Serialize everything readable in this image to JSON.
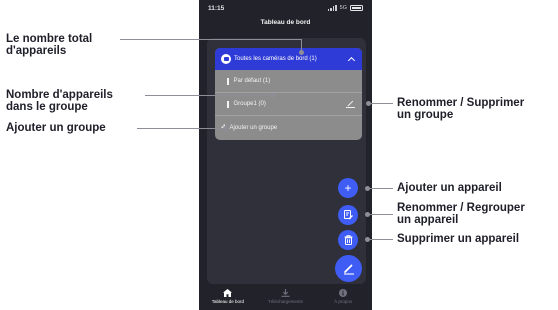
{
  "status_bar": {
    "time": "11:15",
    "network": "5G"
  },
  "header": {
    "title": "Tableau de bord"
  },
  "group_panel": {
    "header_label": "Toutes les caméras de bord (1)",
    "groups": [
      {
        "label": "Par défaut (1)"
      },
      {
        "label": "Groupe1 (0)"
      }
    ],
    "add_group_label": "Ajouter un groupe"
  },
  "bottom_nav": {
    "items": [
      {
        "label": "Tableau de bord",
        "icon": "home-icon",
        "active": true
      },
      {
        "label": "Téléchargements",
        "icon": "download-icon",
        "active": false
      },
      {
        "label": "À propos",
        "icon": "info-icon",
        "active": false
      }
    ]
  },
  "annotations": {
    "total_devices": [
      "Le nombre total",
      "d'appareils"
    ],
    "devices_in_group": [
      "Nombre d'appareils",
      "dans le groupe"
    ],
    "add_group": "Ajouter un groupe",
    "rename_delete_group": [
      "Renommer / Supprimer",
      "un groupe"
    ],
    "add_device": "Ajouter un appareil",
    "rename_regroup_device": [
      "Renommer / Regrouper",
      "un appareil"
    ],
    "delete_device": "Supprimer un appareil"
  },
  "colors": {
    "accent": "#3f5cf5",
    "header_blue": "#2f3bd6",
    "background": "#22232a",
    "panel_grey": "#8c8c8c"
  }
}
